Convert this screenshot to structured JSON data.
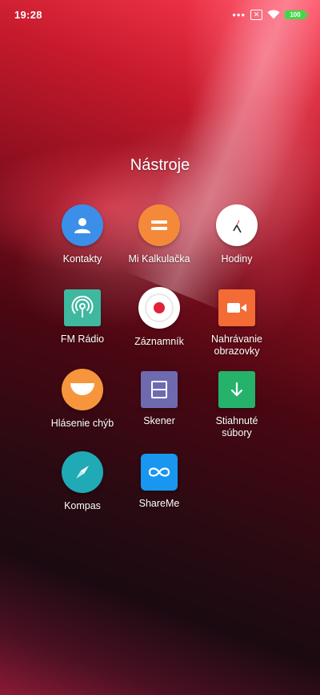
{
  "status_bar": {
    "time": "19:28",
    "dots": "•••",
    "sim_icon": "no-sim-icon",
    "sim_glyph": "✕",
    "wifi_icon": "wifi-icon",
    "battery_level": "100",
    "battery_color": "#3ddc47"
  },
  "folder": {
    "title": "Nástroje",
    "apps": [
      {
        "label": "Kontakty",
        "icon": "contacts-icon",
        "color": "#3b8fe8"
      },
      {
        "label": "Mi Kalkulačka",
        "icon": "calculator-icon",
        "color": "#f5893a"
      },
      {
        "label": "Hodiny",
        "icon": "clock-icon",
        "color": "#ffffff"
      },
      {
        "label": "FM Rádio",
        "icon": "radio-icon",
        "color": "#3fb8a0"
      },
      {
        "label": "Záznamník",
        "icon": "recorder-icon",
        "color": "#ffffff"
      },
      {
        "label": "Nahrávanie\nobrazovky",
        "icon": "screen-recorder-icon",
        "color": "#f36b35"
      },
      {
        "label": "Hlásenie chýb",
        "icon": "feedback-icon",
        "color": "#f7953c"
      },
      {
        "label": "Skener",
        "icon": "scanner-icon",
        "color": "#6e6ab0"
      },
      {
        "label": "Stiahnuté\nsúbory",
        "icon": "download-icon",
        "color": "#25b26b"
      },
      {
        "label": "Kompas",
        "icon": "compass-icon",
        "color": "#1faab5"
      },
      {
        "label": "ShareMe",
        "icon": "shareme-icon",
        "color": "#1996f0"
      }
    ]
  }
}
